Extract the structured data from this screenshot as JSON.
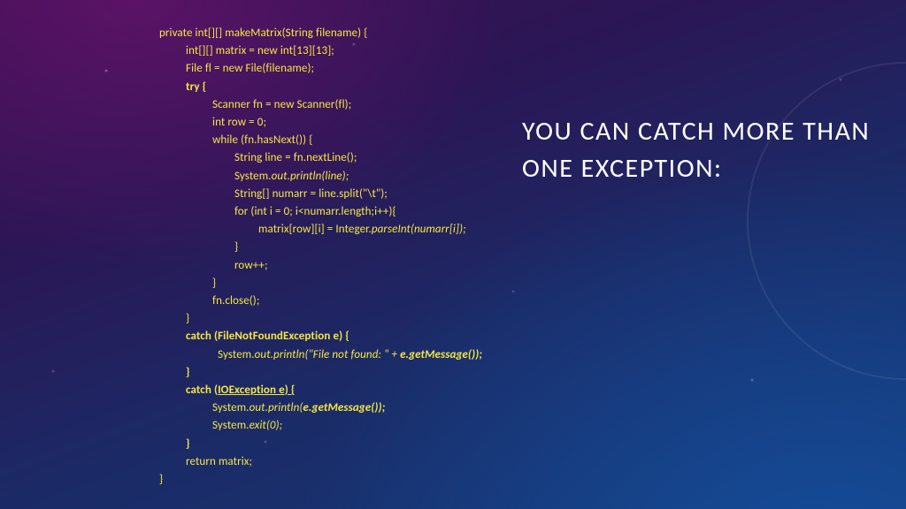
{
  "title": "YOU CAN CATCH MORE THAN ONE EXCEPTION:",
  "code": {
    "l1a": "private int[][] makeMatrix(String filename) {",
    "l2a": "int[][] matrix = new int[13][13];",
    "l3a": "File fl = new File(filename);",
    "l4a": "try {",
    "l5a": "Scanner fn = new Scanner(fl);",
    "l6a": "int row = 0;",
    "l7a": "while (fn.hasNext()) {",
    "l8a": "String line = fn.nextLine();",
    "l9a": "System.",
    "l9b": "out.println(line);",
    "l10a": "String[] numarr = line.split(\"\\t\");",
    "l11a": "for (int i = 0; i<numarr.length;i++){",
    "l12a": "matrix[row][i] = Integer.",
    "l12b": "parseInt(numarr[i]);",
    "l13a": "}",
    "l14a": "row++;",
    "l15a": "}",
    "l16a": "fn.close();",
    "l17a": "}",
    "l18a": "catch (FileNotFoundException e) {",
    "l19a": "  System.",
    "l19b": "out.println(\"File not found: \" + ",
    "l19c": "e.getMessage());",
    "l20a": "}",
    "l21a": "catch (",
    "l21b": "IOException e) {",
    "l22a": "System.",
    "l22b": "out.println(",
    "l22c": "e.getMessage());",
    "l23a": "System.",
    "l23b": "exit(0);",
    "l24a": "}",
    "l25a": "return matrix;",
    "l26a": "}"
  }
}
